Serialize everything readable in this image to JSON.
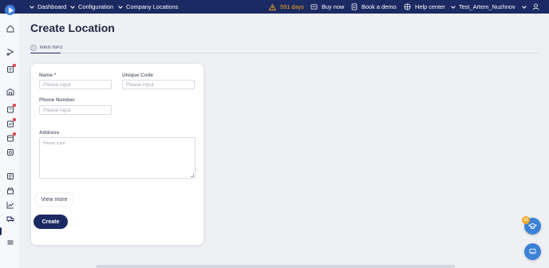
{
  "topbar": {
    "nav": [
      "Dashboard",
      "Configuration",
      "Company Locations"
    ],
    "trial": "591 days",
    "buy_now": "Buy now",
    "book_demo": "Book a demo",
    "help_center": "Help center",
    "user": "Test_Artem_Nuzhnov"
  },
  "sidebar": {
    "icons": [
      "home-icon",
      "route-icon",
      "orders-icon",
      "warehouse-icon",
      "inventory-icon",
      "shipments-icon",
      "calendar-icon",
      "settings-icon",
      "reports-icon",
      "store-icon",
      "analytics-icon",
      "truck-icon",
      "layers-icon"
    ]
  },
  "page": {
    "title": "Create Location",
    "tab_number": "1",
    "tab_label": "MAIN INFO"
  },
  "form": {
    "name_label": "Name *",
    "name_placeholder": "Please input",
    "code_label": "Unique Code",
    "code_placeholder": "Please input",
    "phone_label": "Phone Number",
    "phone_placeholder": "Please input",
    "address_label": "Address",
    "address_placeholder": "Please input",
    "view_more": "View more",
    "create": "Create"
  },
  "floating": {
    "badge": "11"
  },
  "colors": {
    "brand": "#1c2a63",
    "accent": "#3b82d6",
    "warning": "#f5a623"
  }
}
